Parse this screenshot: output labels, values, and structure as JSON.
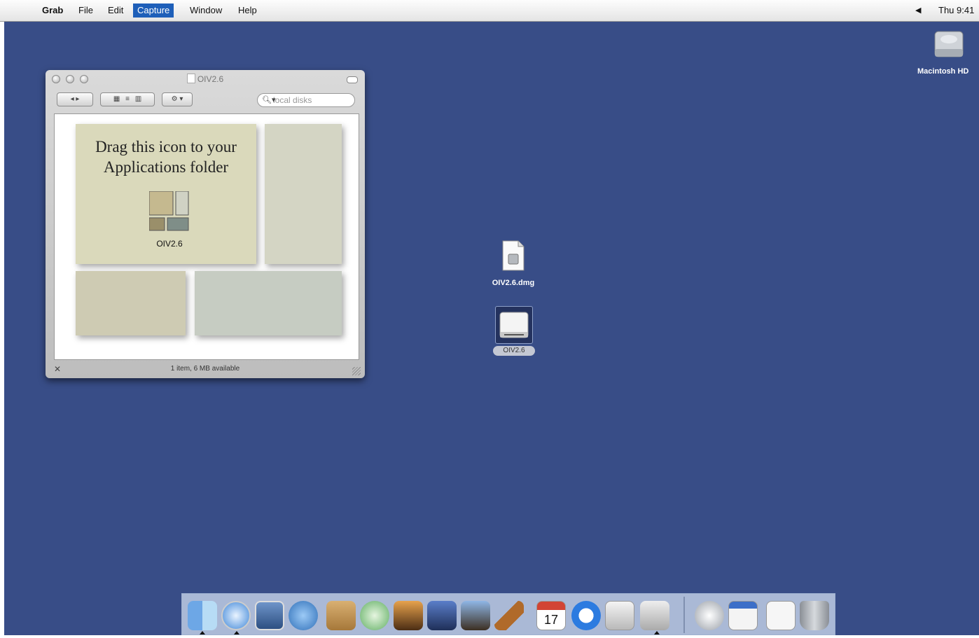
{
  "menubar": {
    "app": "Grab",
    "items": [
      "File",
      "Edit",
      "Capture",
      "Window",
      "Help"
    ],
    "clock": "Thu 9:41",
    "volume_icon": "speaker-icon"
  },
  "desktop": {
    "hd_label": "Macintosh HD",
    "dmg_label": "OIV2.6.dmg",
    "volume_label": "OIV2.6"
  },
  "window": {
    "title": "OIV2.6",
    "search_placeholder": "local disks",
    "background_text_line1": "Drag this icon to your",
    "background_text_line2": "Applications folder",
    "app_label": "OIV2.6",
    "status": "1 item, 6 MB available"
  },
  "dock": {
    "apps": [
      "finder-icon",
      "safari-icon",
      "preview-icon",
      "ichat-icon",
      "address-book-icon",
      "itunes-icon",
      "iphoto-icon",
      "imovie-icon",
      "idvd-icon",
      "garageband-icon",
      "ical-icon",
      "quicktime-icon",
      "system-preferences-icon",
      "grab-icon"
    ],
    "docs": [
      "mail-icon",
      "web-document-icon",
      "text-document-icon",
      "trash-icon"
    ],
    "colors": {
      "bg": "#384d87",
      "dock": "#becce4"
    }
  }
}
